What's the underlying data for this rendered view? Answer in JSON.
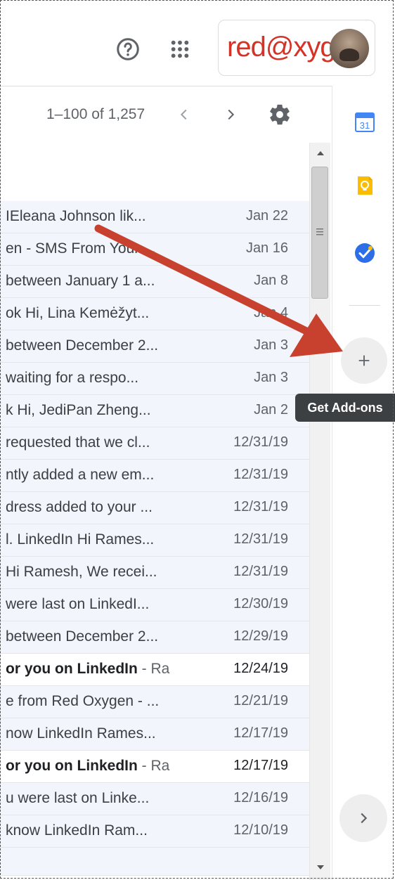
{
  "header": {
    "logo_text": "red@xygen",
    "help_icon": "help-circle-icon",
    "apps_icon": "apps-grid-icon"
  },
  "toolbar": {
    "range_label": "1–100 of 1,257",
    "prev_icon": "chevron-left-icon",
    "next_icon": "chevron-right-icon",
    "settings_icon": "gear-icon"
  },
  "mail_list": {
    "rows": [
      {
        "snippet": "IEleana Johnson lik...",
        "date": "Jan 22",
        "unread": false
      },
      {
        "snippet": "en - SMS From Your ...",
        "date": "Jan 16",
        "unread": false
      },
      {
        "snippet": "between January 1 a...",
        "date": "Jan 8",
        "unread": false
      },
      {
        "snippet": "ok Hi, Lina Kemėžyt...",
        "date": "Jan 4",
        "unread": false
      },
      {
        "snippet": "between December 2...",
        "date": "Jan 3",
        "unread": false
      },
      {
        "snippet": "waiting for a respo...",
        "date": "Jan 3",
        "unread": false
      },
      {
        "snippet": "k Hi, JediPan Zheng...",
        "date": "Jan 2",
        "unread": false
      },
      {
        "snippet": "requested that we cl...",
        "date": "12/31/19",
        "unread": false
      },
      {
        "snippet": "ntly added a new em...",
        "date": "12/31/19",
        "unread": false
      },
      {
        "snippet": "dress added to your ...",
        "date": "12/31/19",
        "unread": false
      },
      {
        "snippet": "l. LinkedIn Hi Rames...",
        "date": "12/31/19",
        "unread": false
      },
      {
        "snippet": "Hi Ramesh, We recei...",
        "date": "12/31/19",
        "unread": false
      },
      {
        "snippet": "were last on LinkedI...",
        "date": "12/30/19",
        "unread": false
      },
      {
        "snippet": "between December 2...",
        "date": "12/29/19",
        "unread": false
      },
      {
        "snippet": "or you on LinkedIn",
        "snippet_rest": " - Ra",
        "date": "12/24/19",
        "unread": true
      },
      {
        "snippet": "e from Red Oxygen - ...",
        "date": "12/21/19",
        "unread": false
      },
      {
        "snippet": "now LinkedIn Rames...",
        "date": "12/17/19",
        "unread": false
      },
      {
        "snippet": "or you on LinkedIn",
        "snippet_rest": " - Ra",
        "date": "12/17/19",
        "unread": true
      },
      {
        "snippet": "u were last on Linke...",
        "date": "12/16/19",
        "unread": false
      },
      {
        "snippet": "know LinkedIn Ram...",
        "date": "12/10/19",
        "unread": false
      },
      {
        "snippet": "",
        "date": "",
        "unread": false
      }
    ]
  },
  "side_panel": {
    "calendar_label": "31",
    "calendar_icon": "calendar-icon",
    "keep_icon": "keep-bulb-icon",
    "tasks_icon": "tasks-check-icon",
    "addon_icon": "plus-icon",
    "addon_tooltip": "Get Add-ons",
    "expand_icon": "chevron-right-icon"
  },
  "colors": {
    "logo_red": "#d63327",
    "arrow_red": "#c8412e",
    "row_read_bg": "#f2f6fc",
    "tooltip_bg": "#3c4043"
  }
}
